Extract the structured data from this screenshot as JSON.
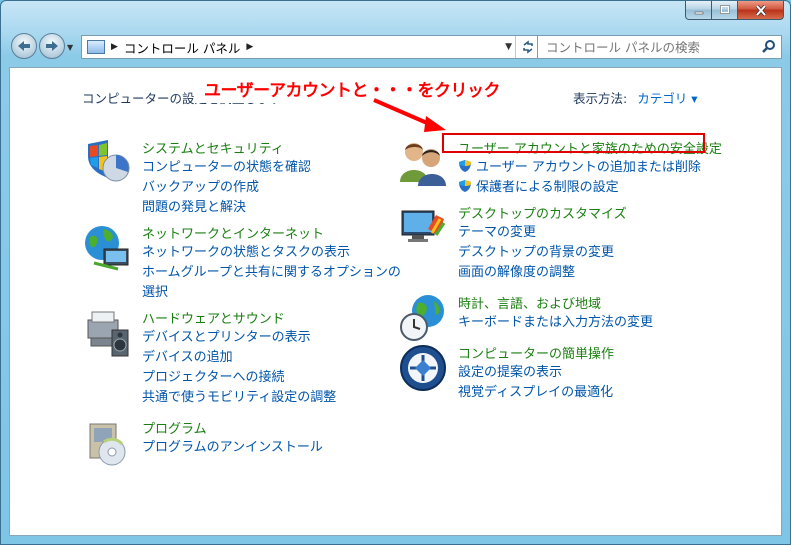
{
  "window": {
    "caption_buttons": {
      "minimize": "minimize-icon",
      "maximize": "maximize-icon",
      "close": "close-icon"
    }
  },
  "nav": {
    "address_crumb": "コントロール パネル",
    "search_placeholder": "コントロール パネルの検索"
  },
  "content": {
    "heading": "コンピューターの設定を調整します",
    "view_by_label": "表示方法:",
    "view_by_value": "カテゴリ",
    "annotation": "ユーザーアカウントと・・・をクリック",
    "left_categories": [
      {
        "icon": "system-security-icon",
        "title": "システムとセキュリティ",
        "links": [
          "コンピューターの状態を確認",
          "バックアップの作成",
          "問題の発見と解決"
        ]
      },
      {
        "icon": "network-internet-icon",
        "title": "ネットワークとインターネット",
        "links": [
          "ネットワークの状態とタスクの表示",
          "ホームグループと共有に関するオプションの",
          "選択"
        ]
      },
      {
        "icon": "hardware-sound-icon",
        "title": "ハードウェアとサウンド",
        "links": [
          "デバイスとプリンターの表示",
          "デバイスの追加",
          "プロジェクターへの接続",
          "共通で使うモビリティ設定の調整"
        ]
      },
      {
        "icon": "programs-icon",
        "title": "プログラム",
        "links": [
          "プログラムのアンインストール"
        ]
      }
    ],
    "right_categories": [
      {
        "icon": "user-accounts-icon",
        "title": "ユーザー アカウントと家族のための安全設定",
        "links": [
          "ユーザー アカウントの追加または削除",
          "保護者による制限の設定"
        ]
      },
      {
        "icon": "appearance-icon",
        "title": "デスクトップのカスタマイズ",
        "links": [
          "テーマの変更",
          "デスクトップの背景の変更",
          "画面の解像度の調整"
        ]
      },
      {
        "icon": "clock-language-region-icon",
        "title": "時計、言語、および地域",
        "links": [
          "キーボードまたは入力方法の変更"
        ]
      },
      {
        "icon": "ease-of-access-icon",
        "title": "コンピューターの簡単操作",
        "links": [
          "設定の提案の表示",
          "視覚ディスプレイの最適化"
        ]
      }
    ]
  }
}
